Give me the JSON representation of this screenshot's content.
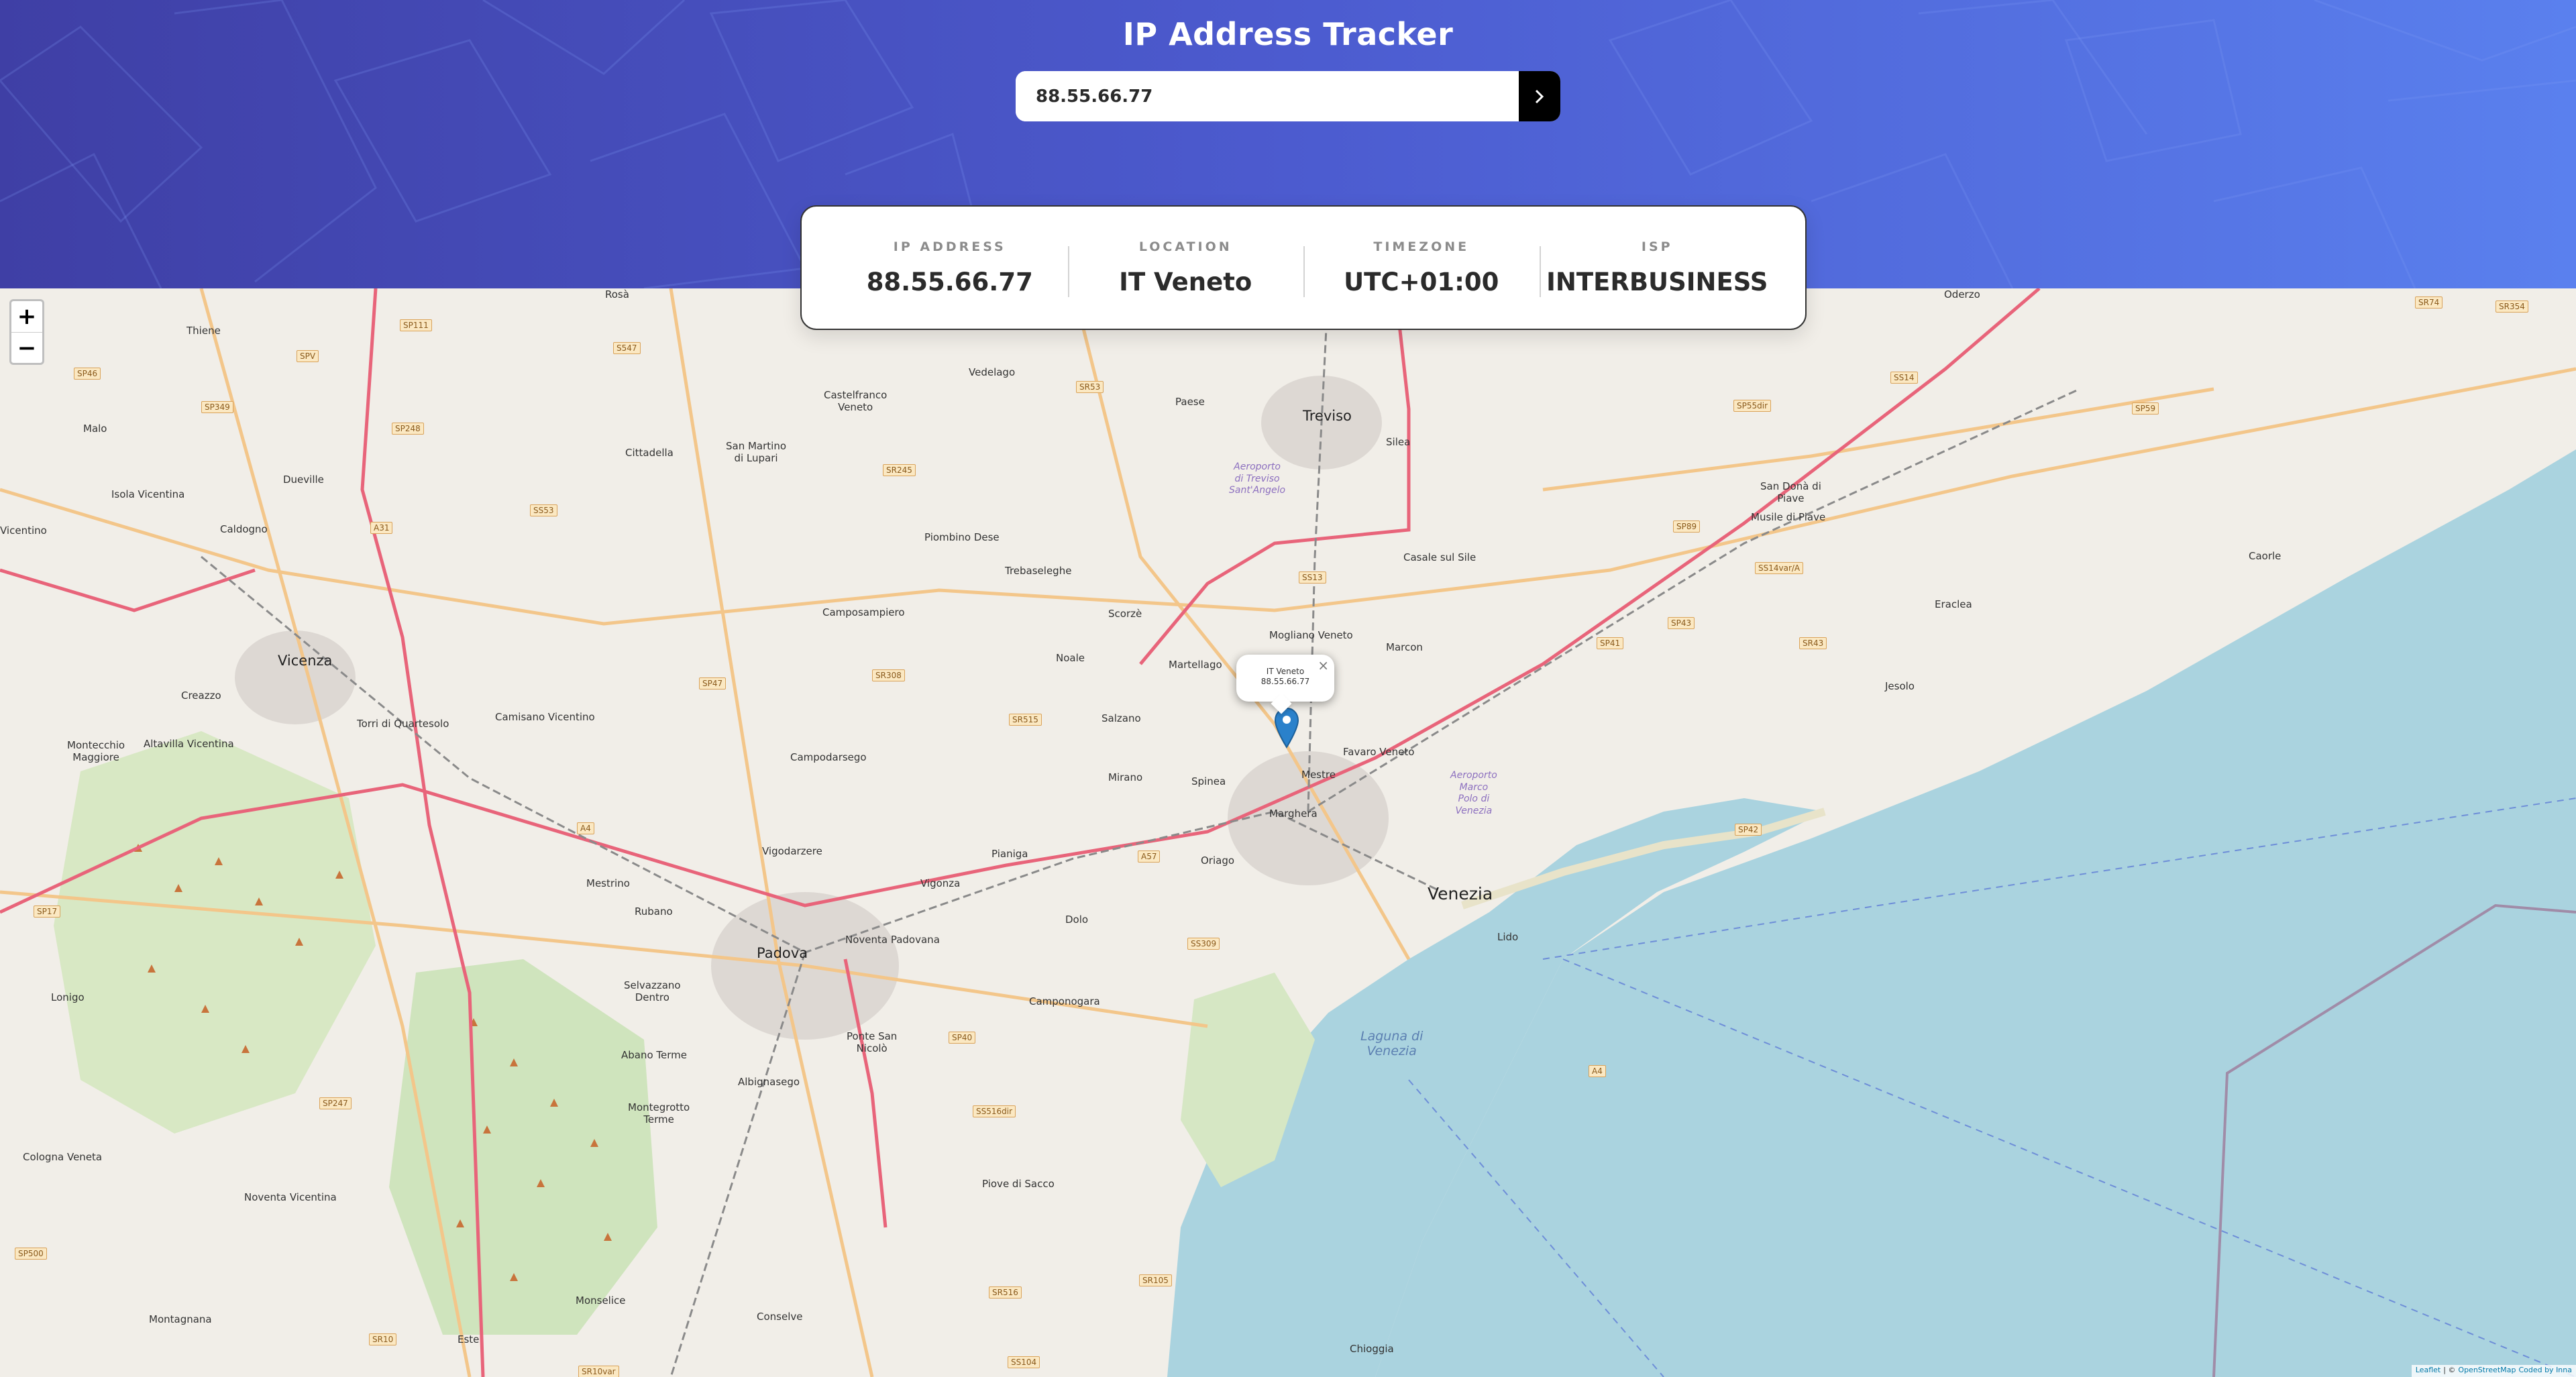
{
  "header": {
    "title": "IP Address Tracker",
    "search_value": "88.55.66.77"
  },
  "info": {
    "ip_label": "IP ADDRESS",
    "ip_value": "88.55.66.77",
    "location_label": "LOCATION",
    "location_value": "IT Veneto",
    "timezone_label": "TIMEZONE",
    "timezone_value": "UTC+01:00",
    "isp_label": "ISP",
    "isp_value": "INTERBUSINESS"
  },
  "map": {
    "zoom_in": "+",
    "zoom_out": "−",
    "popup": {
      "line1": "IT Veneto",
      "line2": "88.55.66.77",
      "close": "×"
    },
    "attribution": {
      "leaflet": "Leaflet",
      "separator": "| ©",
      "osm": "OpenStreetMap",
      "coded": "Coded by Inna"
    },
    "labels": {
      "treviso": "Treviso",
      "vicenza": "Vicenza",
      "padova": "Padova",
      "venezia": "Venezia",
      "mestre": "Mestre",
      "marghera": "Marghera",
      "thiene": "Thiene",
      "malo": "Malo",
      "dueville": "Dueville",
      "isola_vicentina": "Isola Vicentina",
      "caldogno": "Caldogno",
      "cittadella": "Cittadella",
      "castelfranco": "Castelfranco\nVeneto",
      "vedelago": "Vedelago",
      "paese": "Paese",
      "silea": "Silea",
      "san_martino": "San Martino\ndi Lupari",
      "piombino": "Piombino Dese",
      "trebaseleghe": "Trebaseleghe",
      "camposampiero": "Camposampiero",
      "scorze": "Scorzè",
      "noale": "Noale",
      "martellago": "Martellago",
      "mogliano": "Mogliano Veneto",
      "marcon": "Marcon",
      "casale": "Casale sul Sile",
      "salzano": "Salzano",
      "mirano": "Mirano",
      "spinea": "Spinea",
      "favaro": "Favaro Veneto",
      "camisano": "Camisano Vicentino",
      "campodarsego": "Campodarsego",
      "torri": "Torri di Quartesolo",
      "creazzo": "Creazzo",
      "altavilla": "Altavilla Vicentina",
      "montecchio": "Montecchio\nMaggiore",
      "mestrino": "Mestrino",
      "rubano": "Rubano",
      "vigodarzere": "Vigodarzere",
      "vigonza": "Vigonza",
      "pianiga": "Pianiga",
      "dolo": "Dolo",
      "oriago": "Oriago",
      "noventa_padovana": "Noventa Padovana",
      "selvazzano": "Selvazzano\nDentro",
      "abano": "Abano Terme",
      "albignasego": "Albignasego",
      "ponte_san_nicolo": "Ponte San\nNicolò",
      "camponogara": "Camponogara",
      "montegrotto": "Montegrotto\nTerme",
      "piove": "Piove di Sacco",
      "monselice": "Monselice",
      "conselve": "Conselve",
      "este": "Este",
      "montagnana": "Montagnana",
      "noventa_vicentina": "Noventa Vicentina",
      "cologna": "Cologna Veneta",
      "lonigo": "Lonigo",
      "lido": "Lido",
      "chioggia": "Chioggia",
      "san_dona": "San Donà di\nPiave",
      "musile": "Musile di Piave",
      "eraclea": "Eraclea",
      "caorle": "Caorle",
      "jesolo": "Jesolo",
      "laguna": "Laguna di\nVenezia",
      "aeroporto_treviso": "Aeroporto\ndi Treviso\nSant'Angelo",
      "aeroporto_venezia": "Aeroporto\nMarco\nPolo di\nVenezia",
      "vicentino": "Vicentino",
      "rosa": "Rosà",
      "oderzo": "Oderzo"
    },
    "road_shields": [
      "SP46",
      "SP349",
      "SPV",
      "SP248",
      "SP111",
      "S547",
      "SR53",
      "SR245",
      "SS53",
      "A31",
      "SS13",
      "SP47",
      "SR308",
      "SR515",
      "A4",
      "SP17",
      "A57",
      "SS309",
      "SP40",
      "SS516dir",
      "SR105",
      "SR516",
      "SS104",
      "SR10",
      "SR10var",
      "SP500",
      "SP247",
      "A4",
      "SP55dir",
      "SS14",
      "SP59",
      "SP89",
      "SS14var/A",
      "SP41",
      "SP43",
      "SR43",
      "SP42",
      "SR74",
      "SR354"
    ]
  }
}
